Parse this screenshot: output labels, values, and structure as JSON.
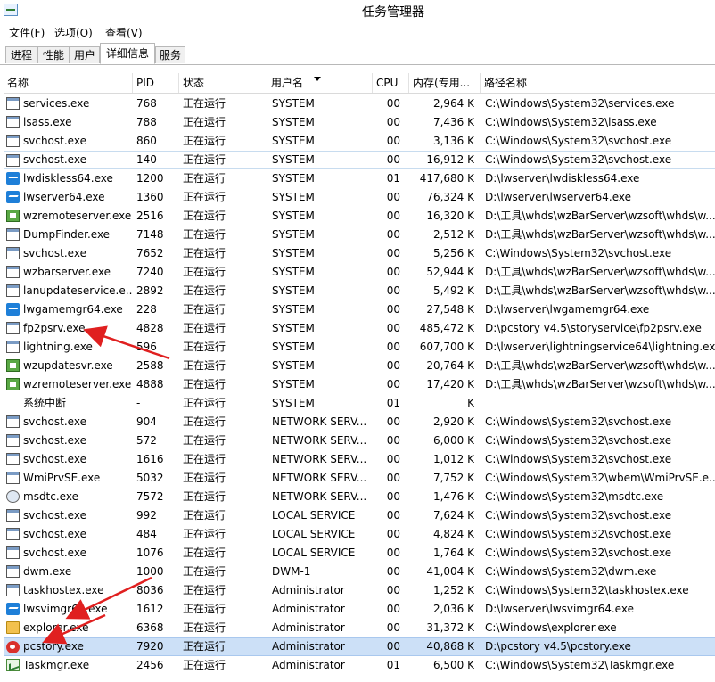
{
  "window": {
    "title": "任务管理器"
  },
  "menu": [
    "文件(F)",
    "选项(O)",
    "查看(V)"
  ],
  "tabs": [
    "进程",
    "性能",
    "用户",
    "详细信息",
    "服务"
  ],
  "active_tab": "详细信息",
  "columns": {
    "name": "名称",
    "pid": "PID",
    "status": "状态",
    "user": "用户名",
    "cpu": "CPU",
    "mem": "内存(专用...",
    "path": "路径名称"
  },
  "rows": [
    {
      "icon": "generic",
      "name": "services.exe",
      "pid": "768",
      "status": "正在运行",
      "user": "SYSTEM",
      "cpu": "00",
      "mem": "2,964 K",
      "path": "C:\\Windows\\System32\\services.exe"
    },
    {
      "icon": "generic",
      "name": "lsass.exe",
      "pid": "788",
      "status": "正在运行",
      "user": "SYSTEM",
      "cpu": "00",
      "mem": "7,436 K",
      "path": "C:\\Windows\\System32\\lsass.exe"
    },
    {
      "icon": "generic",
      "name": "svchost.exe",
      "pid": "860",
      "status": "正在运行",
      "user": "SYSTEM",
      "cpu": "00",
      "mem": "3,136 K",
      "path": "C:\\Windows\\System32\\svchost.exe"
    },
    {
      "icon": "generic",
      "name": "svchost.exe",
      "pid": "140",
      "status": "正在运行",
      "user": "SYSTEM",
      "cpu": "00",
      "mem": "16,912 K",
      "path": "C:\\Windows\\System32\\svchost.exe"
    },
    {
      "icon": "lw",
      "name": "lwdiskless64.exe",
      "pid": "1200",
      "status": "正在运行",
      "user": "SYSTEM",
      "cpu": "01",
      "mem": "417,680 K",
      "path": "D:\\lwserver\\lwdiskless64.exe"
    },
    {
      "icon": "lw",
      "name": "lwserver64.exe",
      "pid": "1360",
      "status": "正在运行",
      "user": "SYSTEM",
      "cpu": "00",
      "mem": "76,324 K",
      "path": "D:\\lwserver\\lwserver64.exe"
    },
    {
      "icon": "wz",
      "name": "wzremoteserver.exe",
      "pid": "2516",
      "status": "正在运行",
      "user": "SYSTEM",
      "cpu": "00",
      "mem": "16,320 K",
      "path": "D:\\工具\\whds\\wzBarServer\\wzsoft\\whds\\w..."
    },
    {
      "icon": "generic",
      "name": "DumpFinder.exe",
      "pid": "7148",
      "status": "正在运行",
      "user": "SYSTEM",
      "cpu": "00",
      "mem": "2,512 K",
      "path": "D:\\工具\\whds\\wzBarServer\\wzsoft\\whds\\w..."
    },
    {
      "icon": "generic",
      "name": "svchost.exe",
      "pid": "7652",
      "status": "正在运行",
      "user": "SYSTEM",
      "cpu": "00",
      "mem": "5,256 K",
      "path": "C:\\Windows\\System32\\svchost.exe"
    },
    {
      "icon": "generic",
      "name": "wzbarserver.exe",
      "pid": "7240",
      "status": "正在运行",
      "user": "SYSTEM",
      "cpu": "00",
      "mem": "52,944 K",
      "path": "D:\\工具\\whds\\wzBarServer\\wzsoft\\whds\\w..."
    },
    {
      "icon": "generic",
      "name": "lanupdateservice.e...",
      "pid": "2892",
      "status": "正在运行",
      "user": "SYSTEM",
      "cpu": "00",
      "mem": "5,492 K",
      "path": "D:\\工具\\whds\\wzBarServer\\wzsoft\\whds\\w..."
    },
    {
      "icon": "lw",
      "name": "lwgamemgr64.exe",
      "pid": "228",
      "status": "正在运行",
      "user": "SYSTEM",
      "cpu": "00",
      "mem": "27,548 K",
      "path": "D:\\lwserver\\lwgamemgr64.exe"
    },
    {
      "icon": "generic",
      "name": "fp2psrv.exe",
      "pid": "4828",
      "status": "正在运行",
      "user": "SYSTEM",
      "cpu": "00",
      "mem": "485,472 K",
      "path": "D:\\pcstory v4.5\\storyservice\\fp2psrv.exe"
    },
    {
      "icon": "generic",
      "name": "lightning.exe",
      "pid": "596",
      "status": "正在运行",
      "user": "SYSTEM",
      "cpu": "00",
      "mem": "607,700 K",
      "path": "D:\\lwserver\\lightningservice64\\lightning.exe"
    },
    {
      "icon": "wz",
      "name": "wzupdatesvr.exe",
      "pid": "2588",
      "status": "正在运行",
      "user": "SYSTEM",
      "cpu": "00",
      "mem": "20,764 K",
      "path": "D:\\工具\\whds\\wzBarServer\\wzsoft\\whds\\w..."
    },
    {
      "icon": "wz",
      "name": "wzremoteserver.exe",
      "pid": "4888",
      "status": "正在运行",
      "user": "SYSTEM",
      "cpu": "00",
      "mem": "17,420 K",
      "path": "D:\\工具\\whds\\wzBarServer\\wzsoft\\whds\\w..."
    },
    {
      "icon": "none",
      "name": "系统中断",
      "pid": "-",
      "status": "正在运行",
      "user": "SYSTEM",
      "cpu": "01",
      "mem": "K",
      "path": ""
    },
    {
      "icon": "generic",
      "name": "svchost.exe",
      "pid": "904",
      "status": "正在运行",
      "user": "NETWORK SERV...",
      "cpu": "00",
      "mem": "2,920 K",
      "path": "C:\\Windows\\System32\\svchost.exe"
    },
    {
      "icon": "generic",
      "name": "svchost.exe",
      "pid": "572",
      "status": "正在运行",
      "user": "NETWORK SERV...",
      "cpu": "00",
      "mem": "6,000 K",
      "path": "C:\\Windows\\System32\\svchost.exe"
    },
    {
      "icon": "generic",
      "name": "svchost.exe",
      "pid": "1616",
      "status": "正在运行",
      "user": "NETWORK SERV...",
      "cpu": "00",
      "mem": "1,012 K",
      "path": "C:\\Windows\\System32\\svchost.exe"
    },
    {
      "icon": "generic",
      "name": "WmiPrvSE.exe",
      "pid": "5032",
      "status": "正在运行",
      "user": "NETWORK SERV...",
      "cpu": "00",
      "mem": "7,752 K",
      "path": "C:\\Windows\\System32\\wbem\\WmiPrvSE.e..."
    },
    {
      "icon": "dtc",
      "name": "msdtc.exe",
      "pid": "7572",
      "status": "正在运行",
      "user": "NETWORK SERV...",
      "cpu": "00",
      "mem": "1,476 K",
      "path": "C:\\Windows\\System32\\msdtc.exe"
    },
    {
      "icon": "generic",
      "name": "svchost.exe",
      "pid": "992",
      "status": "正在运行",
      "user": "LOCAL SERVICE",
      "cpu": "00",
      "mem": "7,624 K",
      "path": "C:\\Windows\\System32\\svchost.exe"
    },
    {
      "icon": "generic",
      "name": "svchost.exe",
      "pid": "484",
      "status": "正在运行",
      "user": "LOCAL SERVICE",
      "cpu": "00",
      "mem": "4,824 K",
      "path": "C:\\Windows\\System32\\svchost.exe"
    },
    {
      "icon": "generic",
      "name": "svchost.exe",
      "pid": "1076",
      "status": "正在运行",
      "user": "LOCAL SERVICE",
      "cpu": "00",
      "mem": "1,764 K",
      "path": "C:\\Windows\\System32\\svchost.exe"
    },
    {
      "icon": "generic",
      "name": "dwm.exe",
      "pid": "1000",
      "status": "正在运行",
      "user": "DWM-1",
      "cpu": "00",
      "mem": "41,004 K",
      "path": "C:\\Windows\\System32\\dwm.exe"
    },
    {
      "icon": "generic",
      "name": "taskhostex.exe",
      "pid": "8036",
      "status": "正在运行",
      "user": "Administrator",
      "cpu": "00",
      "mem": "1,252 K",
      "path": "C:\\Windows\\System32\\taskhostex.exe"
    },
    {
      "icon": "lw",
      "name": "lwsvimgr64.exe",
      "pid": "1612",
      "status": "正在运行",
      "user": "Administrator",
      "cpu": "00",
      "mem": "2,036 K",
      "path": "D:\\lwserver\\lwsvimgr64.exe"
    },
    {
      "icon": "folder",
      "name": "explorer.exe",
      "pid": "6368",
      "status": "正在运行",
      "user": "Administrator",
      "cpu": "00",
      "mem": "31,372 K",
      "path": "C:\\Windows\\explorer.exe"
    },
    {
      "icon": "pc",
      "name": "pcstory.exe",
      "pid": "7920",
      "status": "正在运行",
      "user": "Administrator",
      "cpu": "00",
      "mem": "40,868 K",
      "path": "D:\\pcstory v4.5\\pcstory.exe",
      "selected": true
    },
    {
      "icon": "task",
      "name": "Taskmgr.exe",
      "pid": "2456",
      "status": "正在运行",
      "user": "Administrator",
      "cpu": "01",
      "mem": "6,500 K",
      "path": "C:\\Windows\\System32\\Taskmgr.exe"
    }
  ]
}
